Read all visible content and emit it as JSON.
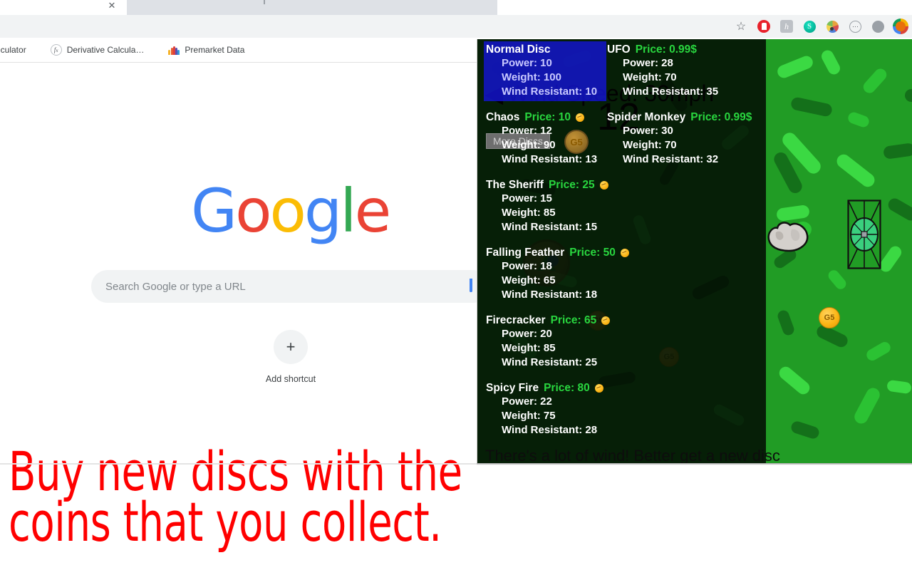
{
  "browser": {
    "tab": {
      "close_icon": "close-icon",
      "title": ""
    },
    "toolbar_icons": [
      {
        "name": "bookmark-star-icon",
        "glyph": "☆"
      },
      {
        "name": "adblock-icon",
        "glyph": ""
      },
      {
        "name": "honey-extension-icon",
        "glyph": "h"
      },
      {
        "name": "teal-extension-icon",
        "glyph": "S"
      },
      {
        "name": "palette-extension-icon",
        "glyph": ""
      },
      {
        "name": "dots-circle-extension-icon",
        "glyph": "(··)"
      },
      {
        "name": "grey-avatar-icon",
        "glyph": ""
      },
      {
        "name": "profile-avatar-icon",
        "glyph": ""
      }
    ],
    "bookmarks": [
      {
        "label": "lculator",
        "icon": "none"
      },
      {
        "label": "Derivative Calcula…",
        "icon": "fx-icon"
      },
      {
        "label": "Premarket Data",
        "icon": "nbc-peacock-icon"
      }
    ]
  },
  "newtab": {
    "logo_letters": [
      {
        "ch": "G",
        "color": "blue"
      },
      {
        "ch": "o",
        "color": "red"
      },
      {
        "ch": "o",
        "color": "yellow"
      },
      {
        "ch": "g",
        "color": "blue"
      },
      {
        "ch": "l",
        "color": "green"
      },
      {
        "ch": "e",
        "color": "red"
      }
    ],
    "search": {
      "placeholder": "Search Google or type a URL",
      "value": "",
      "mic_icon": "microphone-icon"
    },
    "add_shortcut": {
      "plus": "+",
      "label": "Add shortcut"
    }
  },
  "overlay": {
    "instruction": "Buy new discs with the coins that you collect.",
    "color": "#ff0000"
  },
  "game": {
    "hud": {
      "wind_label": "Wind Speed: 30mph",
      "wind_arrow": "◀",
      "score": "12"
    },
    "more_discs_button": "More Discs",
    "bottom_message": "There's a lot of wind! Better get a new disc",
    "selected_disc": "Normal Disc",
    "stat_labels": {
      "power": "Power",
      "weight": "Weight",
      "wind": "Wind Resistant"
    },
    "price_label": "Price:",
    "discs": [
      {
        "name": "Normal Disc",
        "price": "",
        "price_visible": false,
        "currency": "",
        "power": "Power: 10",
        "weight": "Weight: 100",
        "wind": "Wind Resistant: 10",
        "selected": true,
        "col": 0,
        "row": 0
      },
      {
        "name": "UFO",
        "price": "Price: 0.99$",
        "price_visible": true,
        "currency": "usd",
        "power": "Power: 28",
        "weight": "Weight: 70",
        "wind": "Wind Resistant: 35",
        "selected": false,
        "col": 1,
        "row": 0
      },
      {
        "name": "Chaos",
        "price": "Price: 10",
        "price_visible": true,
        "currency": "coin",
        "power": "Power: 12",
        "weight": "Weight: 90",
        "wind": "Wind Resistant: 13",
        "selected": false,
        "col": 0,
        "row": 1
      },
      {
        "name": "Spider Monkey",
        "price": "Price: 0.99$",
        "price_visible": true,
        "currency": "usd",
        "power": "Power: 30",
        "weight": "Weight: 70",
        "wind": "Wind Resistant: 32",
        "selected": false,
        "col": 1,
        "row": 1
      },
      {
        "name": "The Sheriff",
        "price": "Price: 25",
        "price_visible": true,
        "currency": "coin",
        "power": "Power: 15",
        "weight": "Weight: 85",
        "wind": "Wind Resistant: 15",
        "selected": false,
        "col": 0,
        "row": 2
      },
      {
        "name": "Falling Feather",
        "price": "Price: 50",
        "price_visible": true,
        "currency": "coin",
        "power": "Power: 18",
        "weight": "Weight: 65",
        "wind": "Wind Resistant: 18",
        "selected": false,
        "col": 0,
        "row": 3
      },
      {
        "name": "Firecracker",
        "price": "Price: 65",
        "price_visible": true,
        "currency": "coin",
        "power": "Power: 20",
        "weight": "Weight: 85",
        "wind": "Wind Resistant: 25",
        "selected": false,
        "col": 0,
        "row": 4
      },
      {
        "name": "Spicy Fire",
        "price": "Price: 80",
        "price_visible": true,
        "currency": "coin",
        "power": "Power: 22",
        "weight": "Weight: 75",
        "wind": "Wind Resistant: 28",
        "selected": false,
        "col": 0,
        "row": 5
      }
    ],
    "field": {
      "coin_label": "G5",
      "coins_visible": 4,
      "rock": "rock-obstacle",
      "basket": "disc-golf-basket"
    },
    "colors": {
      "grass": "#219c25",
      "panel_dim": "rgba(0,0,0,0.8)",
      "price_green": "#29d63f",
      "selection_blue": "#1414dd"
    }
  }
}
